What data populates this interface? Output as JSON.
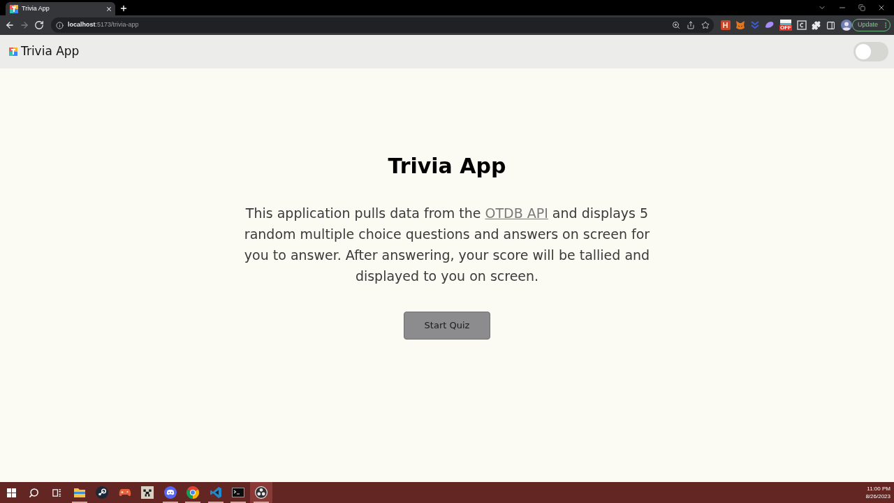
{
  "browser": {
    "tabs": [
      {
        "title": "Trivia App",
        "selected": true
      }
    ],
    "nav_buttons": [
      {
        "kind": "back",
        "disabled": false
      },
      {
        "kind": "forward",
        "disabled": true
      },
      {
        "kind": "reload",
        "disabled": false
      }
    ],
    "address": {
      "host": "localhost",
      "path": ":5173/trivia-app"
    },
    "omnibox_icons": [
      {
        "kind": "zoom"
      },
      {
        "kind": "share"
      },
      {
        "kind": "star"
      }
    ],
    "extensions": [
      {
        "kind": "letter-tile"
      },
      {
        "kind": "fox"
      },
      {
        "kind": "chevrons"
      },
      {
        "kind": "blob"
      },
      {
        "kind": "monitor",
        "badge": "OFF"
      },
      {
        "kind": "frame"
      },
      {
        "kind": "puzzle"
      },
      {
        "kind": "side-panel"
      },
      {
        "kind": "avatar"
      }
    ],
    "update_button": "Update"
  },
  "app": {
    "header": {
      "title": "Trivia App",
      "theme_toggle": {
        "on": false
      }
    },
    "main": {
      "title": "Trivia App",
      "intro": {
        "before": "This application pulls data from the ",
        "link": "OTDB API",
        "after": " and displays 5 random multiple choice questions and answers on screen for you to answer. After answering, your score will be tallied and displayed to you on screen."
      },
      "start_button": "Start Quiz"
    }
  },
  "taskbar": {
    "apps": [
      {
        "kind": "folder",
        "running": true,
        "active": false
      },
      {
        "kind": "steam",
        "running": false,
        "active": false
      },
      {
        "kind": "gamepad",
        "running": false,
        "active": false
      },
      {
        "kind": "blocky-face",
        "running": false,
        "active": false
      },
      {
        "kind": "chat",
        "running": true,
        "active": false
      },
      {
        "kind": "browser",
        "running": true,
        "active": false
      },
      {
        "kind": "code-editor",
        "running": true,
        "active": false
      },
      {
        "kind": "terminal",
        "running": true,
        "active": false
      },
      {
        "kind": "recorder",
        "running": true,
        "active": true
      }
    ],
    "clock": {
      "time": "11:00 PM",
      "date": "8/26/2023"
    }
  }
}
